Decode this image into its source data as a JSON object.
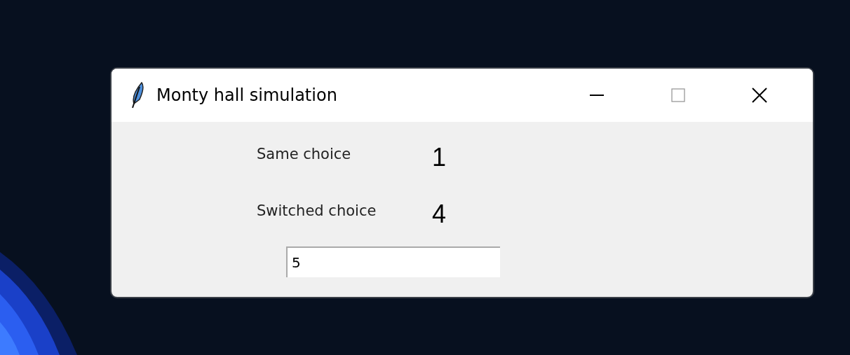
{
  "window": {
    "title": "Monty hall simulation"
  },
  "results": [
    {
      "label": "Same choice",
      "count": "1"
    },
    {
      "label": "Switched choice",
      "count": "4"
    }
  ],
  "entry": {
    "value": "5"
  }
}
